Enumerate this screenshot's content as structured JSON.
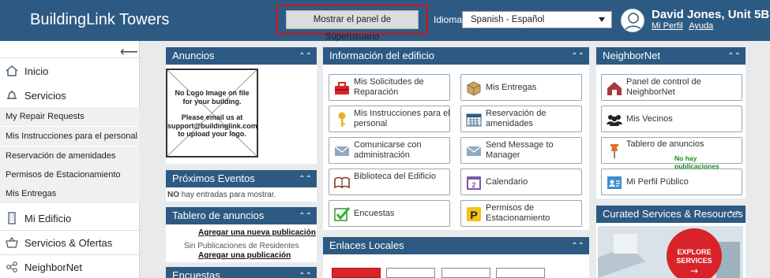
{
  "header": {
    "brand": "BuildingLink Towers",
    "super_button": "Mostrar el panel de Súperusuario",
    "language_label": "Idioma:",
    "language_value": "Spanish - Español",
    "user_name": "David Jones, Unit 5B",
    "profile_link": "Mi Perfil",
    "help_link": "Ayuda"
  },
  "sidebar": {
    "items": [
      {
        "label": "Inicio",
        "icon": "home-icon"
      },
      {
        "label": "Servicios",
        "icon": "bell-icon"
      }
    ],
    "sub_items": [
      "My Repair Requests",
      "Mis Instrucciones para el personal",
      "Reservación de amenidades",
      "Permisos de Estacionamiento",
      "Mis Entregas"
    ],
    "bottom_items": [
      {
        "label": "Mi Edificio",
        "icon": "building-icon"
      },
      {
        "label": "Servicios & Ofertas",
        "icon": "basket-icon"
      },
      {
        "label": "NeighborNet",
        "icon": "network-icon"
      }
    ]
  },
  "anuncios": {
    "title": "Anuncios",
    "logo_text": [
      "No Logo Image on file",
      "for your building.",
      "",
      "Please email us at",
      "support@buildinglink.com",
      "to upload your logo."
    ]
  },
  "eventos": {
    "title": "Próximos Eventos",
    "empty_bold": "NO",
    "empty_text": "hay entradas para mostrar."
  },
  "tablero": {
    "title": "Tablero de anuncios",
    "add_link": "Agregar una nueva publicación",
    "none_text": "Sin Publicaciones de Residentes",
    "add_short": "Agregar una publicación"
  },
  "encuestas": {
    "title": "Encuestas"
  },
  "info": {
    "title": "Información del edificio",
    "tiles": [
      {
        "label": "Mis Solicitudes de Reparación",
        "icon": "toolbox-icon"
      },
      {
        "label": "Mis Entregas",
        "icon": "package-icon"
      },
      {
        "label": "Mis Instrucciones para el personal",
        "icon": "key-icon"
      },
      {
        "label": "Reservación de amenidades",
        "icon": "calendar-grid-icon"
      },
      {
        "label": "Comunicarse con administración",
        "icon": "envelope-icon"
      },
      {
        "label": "Send Message to Manager",
        "icon": "envelope-icon"
      },
      {
        "label": "Biblioteca del Edificio",
        "icon": "book-icon"
      },
      {
        "label": "Calendario",
        "icon": "calendar-icon"
      },
      {
        "label": "Encuestas",
        "icon": "checkmark-icon"
      },
      {
        "label": "Permisos de Estacionamiento",
        "icon": "parking-icon"
      }
    ]
  },
  "enlaces": {
    "title": "Enlaces Locales"
  },
  "neighbornet": {
    "title": "NeighborNet",
    "tiles": [
      {
        "label": "Panel de control de NeighborNet",
        "icon": "house-icon"
      },
      {
        "label": "Mis Vecinos",
        "icon": "people-icon"
      },
      {
        "label": "Tablero de anuncios",
        "icon": "pushpin-icon",
        "sub": "No hay publicaciones"
      },
      {
        "label": "Mi Perfil Público",
        "icon": "profile-card-icon"
      }
    ]
  },
  "curated": {
    "title": "Curated Services & Resources",
    "badge_line1": "EXPLORE",
    "badge_line2": "SERVICES",
    "badge_arrow": "→"
  },
  "colors": {
    "header_bg": "#2d5a82",
    "highlight_border": "#d0121b",
    "success_green": "#1a8a1a"
  }
}
